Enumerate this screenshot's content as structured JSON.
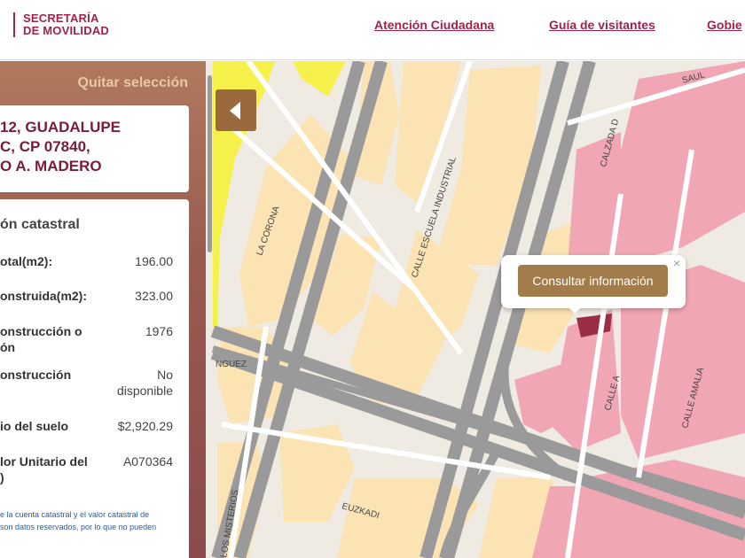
{
  "header": {
    "logo_line1": "SECRETARÍA",
    "logo_line2": "DE MOVILIDAD",
    "nav": [
      "Atención Ciudadana",
      "Guía de visitantes",
      "Gobie"
    ]
  },
  "panel": {
    "clear_label": "Quitar selección",
    "address_lines": [
      "12, GUADALUPE",
      "C, CP 07840,",
      "O A. MADERO"
    ],
    "section_title": "ón catastral",
    "rows": [
      {
        "label": [
          "otal(m2):"
        ],
        "value": [
          "196.00"
        ]
      },
      {
        "label": [
          "onstruida(m2):"
        ],
        "value": [
          "323.00"
        ]
      },
      {
        "label": [
          "onstrucción o",
          "ón"
        ],
        "value": [
          "1976"
        ]
      },
      {
        "label": [
          "onstrucción"
        ],
        "value": [
          "No",
          "disponible"
        ]
      },
      {
        "label": [
          "io del suelo"
        ],
        "value": [
          "$2,920.29"
        ]
      },
      {
        "label": [
          "lor Unitario del",
          ")"
        ],
        "value": [
          "A070364"
        ]
      }
    ],
    "note_lines": [
      "e la cuenta catastral y el valor catastral de",
      "son datos reservados, por lo que no pueden"
    ]
  },
  "map": {
    "street_labels": [
      "LA CORONA",
      "CALLE ESCUELA INDUSTRIAL",
      "CALZADA D",
      "CALLE A",
      "CALLE AMALIA",
      "SAUL",
      "EUZKADI",
      "LOS MISTERIOS",
      "NGUEZ"
    ],
    "colors": {
      "block": "#fbe3b4",
      "commercial": "#f1a7b3",
      "park": "#f5f14a",
      "road": "#9a9a9a",
      "selected": "#9b2d45"
    }
  },
  "popup": {
    "button_label": "Consultar información",
    "close_symbol": "×"
  },
  "toggle": {
    "icon": "triangle-left-icon"
  }
}
